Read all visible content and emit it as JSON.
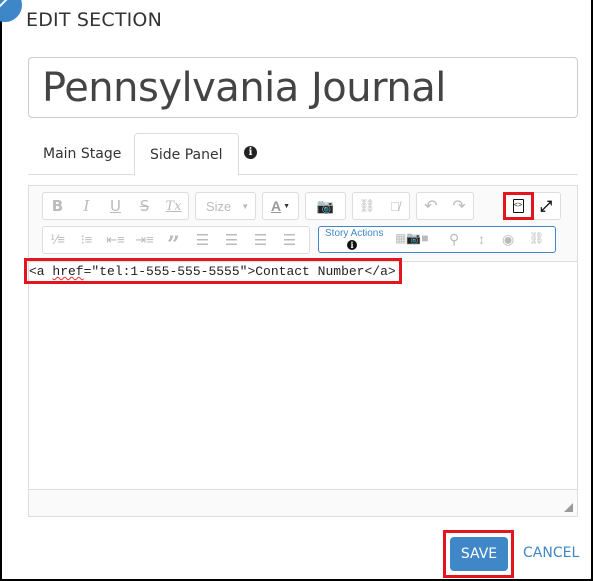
{
  "dialog": {
    "title": "EDIT SECTION",
    "section_name": "Pennsylvania Journal"
  },
  "tabs": [
    {
      "label": "Main Stage",
      "active": false
    },
    {
      "label": "Side Panel",
      "active": true
    }
  ],
  "tab_info_icon": "info-circle-icon",
  "toolbar": {
    "row1": {
      "format": [
        "B",
        "I",
        "U",
        "S",
        "Tx"
      ],
      "size_label": "Size",
      "font_color_label": "A",
      "media_icon": "camera-video-icon",
      "link_icons": [
        "link-icon",
        "unlink-icon"
      ],
      "history_icons": [
        "undo-icon",
        "redo-icon"
      ],
      "source_icon": "source-code-icon",
      "maximize_icon": "maximize-icon"
    },
    "row2": {
      "list_icons": [
        "numbered-list-icon",
        "bulleted-list-icon",
        "outdent-icon",
        "indent-icon",
        "blockquote-icon"
      ],
      "align_icons": [
        "align-left-icon",
        "align-center-icon",
        "align-right-icon",
        "justify-icon"
      ],
      "story_actions_label": "Story Actions",
      "story_icons": [
        "map-media-icon",
        "location-pin-icon",
        "vertical-arrows-icon",
        "eye-icon",
        "unlink-action-icon"
      ]
    }
  },
  "editor": {
    "code_prefix": "<a ",
    "code_attr": "href",
    "code_suffix": "=\"tel:1-555-555-5555\">Contact Number</a>"
  },
  "highlight_color": "#e3151e",
  "accent_color": "#3f87c6",
  "actions": {
    "save_label": "SAVE",
    "cancel_label": "CANCEL"
  }
}
